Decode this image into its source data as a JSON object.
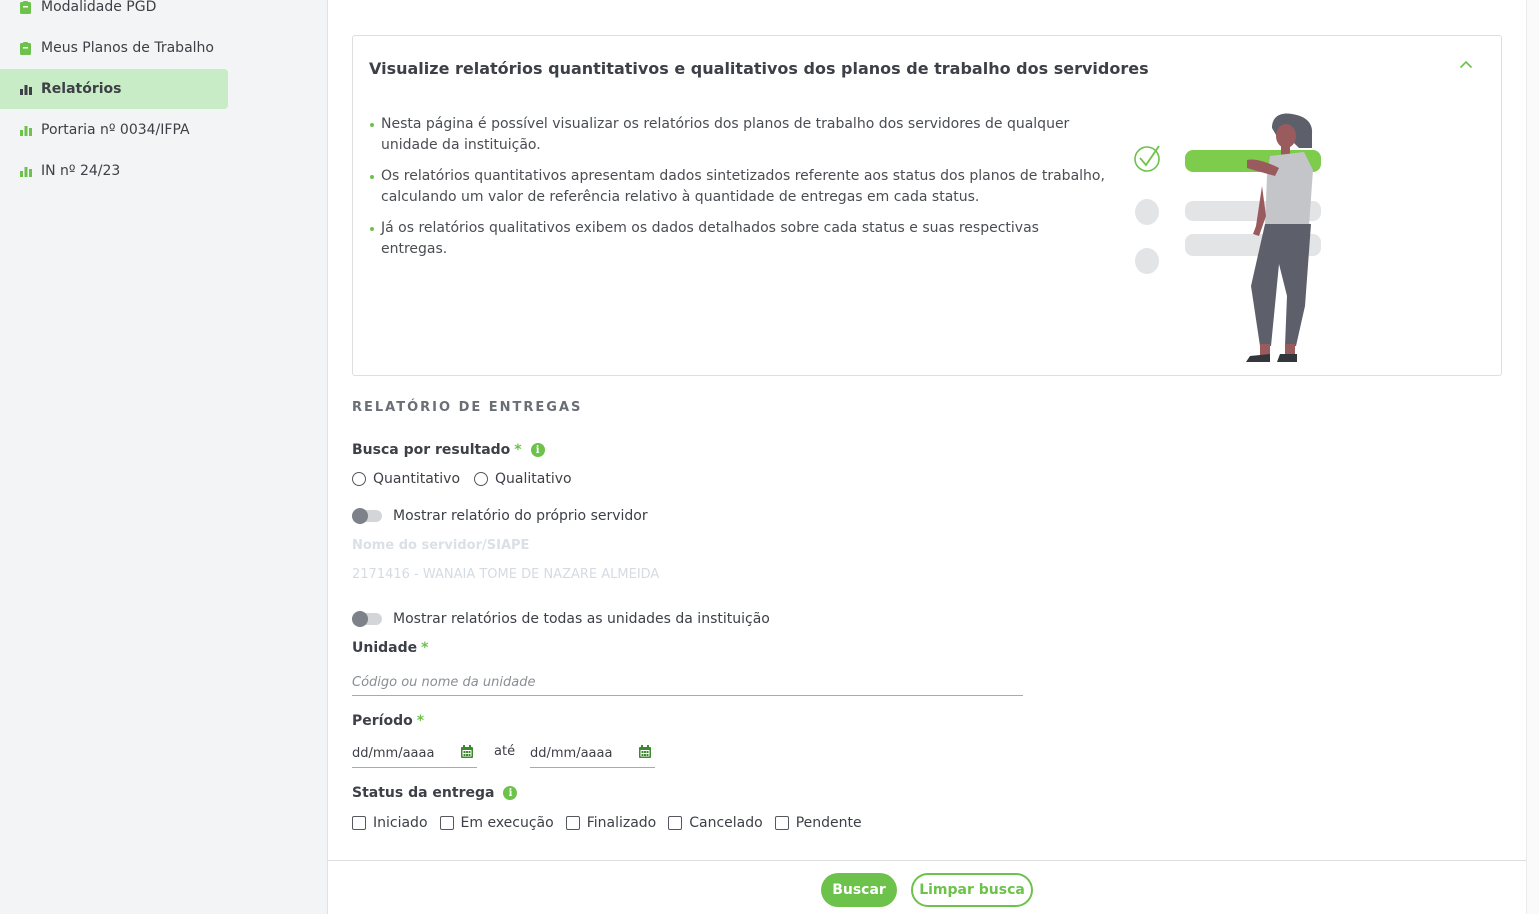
{
  "sidebar": {
    "items": [
      {
        "label": "Modalidade PGD",
        "icon": "clipboard-icon"
      },
      {
        "label": "Meus Planos de Trabalho",
        "icon": "clipboard-icon"
      },
      {
        "label": "Relatórios",
        "icon": "bar-chart-icon",
        "active": true
      },
      {
        "label": "Portaria nº 0034/IFPA",
        "icon": "bar-chart-icon"
      },
      {
        "label": "IN nº 24/23",
        "icon": "bar-chart-icon"
      }
    ]
  },
  "info_card": {
    "title": "Visualize relatórios quantitativos e qualitativos dos planos de trabalho dos servidores",
    "bullets": [
      "Nesta página é possível visualizar os relatórios dos planos de trabalho dos servidores de qualquer unidade da instituição.",
      "Os relatórios quantitativos apresentam dados sintetizados referente aos status dos planos de trabalho, calculando um valor de referência relativo à quantidade de entregas em cada status.",
      "Já os relatórios qualitativos exibem os dados detalhados sobre cada status e suas respectivas entregas."
    ]
  },
  "form": {
    "section_title": "RELATÓRIO DE ENTREGAS",
    "search_by": {
      "label": "Busca por resultado",
      "required_mark": "*",
      "options": [
        "Quantitativo",
        "Qualitativo"
      ]
    },
    "own_report_toggle": "Mostrar relatório do próprio servidor",
    "server_field": {
      "label": "Nome do servidor/SIAPE",
      "value": "2171416 - WANAIA TOME DE NAZARE ALMEIDA"
    },
    "all_units_toggle": "Mostrar relatórios de todas as unidades da instituição",
    "unit": {
      "label": "Unidade",
      "required_mark": "*",
      "placeholder": "Código ou nome da unidade"
    },
    "period": {
      "label": "Período",
      "required_mark": "*",
      "start_placeholder": "dd/mm/aaaa",
      "until": "até",
      "end_placeholder": "dd/mm/aaaa"
    },
    "status": {
      "label": "Status da entrega",
      "options": [
        "Iniciado",
        "Em execução",
        "Finalizado",
        "Cancelado",
        "Pendente"
      ]
    }
  },
  "actions": {
    "search": "Buscar",
    "clear": "Limpar busca"
  },
  "colors": {
    "accent": "#6cc24a",
    "active_nav_bg": "#c8ecc6",
    "text": "#3d4046"
  }
}
